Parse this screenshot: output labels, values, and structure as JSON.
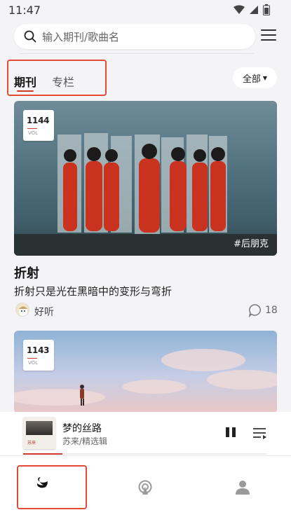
{
  "status_bar": {
    "time": "11:47"
  },
  "search": {
    "placeholder": "输入期刊/歌曲名"
  },
  "tabs": [
    {
      "label": "期刊",
      "active": true
    },
    {
      "label": "专栏",
      "active": false
    }
  ],
  "filter": {
    "label": "全部"
  },
  "cards": [
    {
      "vol_number": "1144",
      "vol_label": "VOL",
      "tag": "#后朋克",
      "title": "折射",
      "subtitle": "折射只是光在黑暗中的变形与弯折",
      "author": "好听",
      "comment_count": "18"
    },
    {
      "vol_number": "1143",
      "vol_label": "VOL"
    }
  ],
  "player": {
    "song_title": "梦的丝路",
    "song_subtitle": "苏来/精选辑",
    "album_text": "苏来",
    "progress": 0.16
  },
  "bottom_nav": [
    {
      "icon": "swan-icon",
      "selected": true
    },
    {
      "icon": "radio-icon",
      "selected": false
    },
    {
      "icon": "user-icon",
      "selected": false
    }
  ],
  "colors": {
    "accent": "#d13a2a",
    "annotation_box": "#e24a3a"
  }
}
